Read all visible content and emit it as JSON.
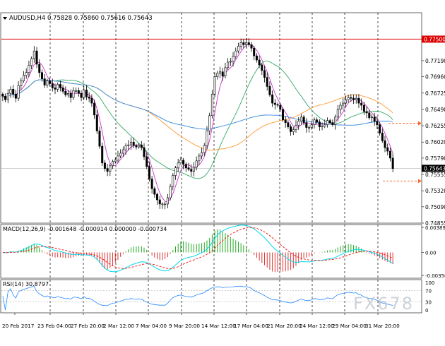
{
  "chart_data": {
    "type": "candlestick",
    "symbol_line": "AUDUSD,H4  0.75828 0.75860 0.75616 0.75643",
    "price_axis": {
      "min": 0.74855,
      "max": 0.7788,
      "ticks": [
        "0.77500",
        "0.77190",
        "0.76960",
        "0.76725",
        "0.76490",
        "0.76255",
        "0.76020",
        "0.75790",
        "0.75555",
        "0.75320",
        "0.75090",
        "0.74855"
      ],
      "current_price_label": "0.75643",
      "current_price": 0.75643,
      "resistance_label": "0.77500",
      "resistance_level": 0.775
    },
    "time_labels": [
      "20 Feb 2017",
      "23 Feb 04:00",
      "27 Feb 20:00",
      "2 Mar 12:00",
      "7 Mar 04:00",
      "9 Mar 20:00",
      "14 Mar 12:00",
      "17 Mar 04:00",
      "21 Mar 20:00",
      "24 Mar 12:00",
      "29 Mar 04:00",
      "31 Mar 20:00"
    ],
    "closes": [
      0.7668,
      0.7663,
      0.7672,
      0.7678,
      0.7671,
      0.7665,
      0.7683,
      0.769,
      0.7698,
      0.7702,
      0.7712,
      0.7722,
      0.7733,
      0.7714,
      0.7702,
      0.7693,
      0.7684,
      0.769,
      0.7686,
      0.768,
      0.7678,
      0.7685,
      0.768,
      0.7675,
      0.767,
      0.7672,
      0.7666,
      0.7676,
      0.7676,
      0.7672,
      0.7666,
      0.7677,
      0.7667,
      0.7665,
      0.7658,
      0.7641,
      0.7618,
      0.7596,
      0.7572,
      0.7564,
      0.756,
      0.7568,
      0.7574,
      0.7576,
      0.7582,
      0.7586,
      0.7591,
      0.7597,
      0.7598,
      0.7602,
      0.7597,
      0.7595,
      0.7598,
      0.7594,
      0.7581,
      0.7567,
      0.7549,
      0.7535,
      0.7527,
      0.7519,
      0.7513,
      0.7513,
      0.7513,
      0.7522,
      0.7538,
      0.7554,
      0.7565,
      0.7572,
      0.7576,
      0.757,
      0.7565,
      0.7563,
      0.756,
      0.7566,
      0.7575,
      0.7582,
      0.7587,
      0.7597,
      0.7618,
      0.764,
      0.7671,
      0.7696,
      0.7701,
      0.7703,
      0.7697,
      0.7709,
      0.7717,
      0.7718,
      0.7725,
      0.7733,
      0.774,
      0.7745,
      0.7742,
      0.7745,
      0.7742,
      0.7737,
      0.7726,
      0.772,
      0.7713,
      0.7705,
      0.7695,
      0.7682,
      0.767,
      0.7658,
      0.7656,
      0.7655,
      0.7649,
      0.7634,
      0.763,
      0.7624,
      0.7617,
      0.762,
      0.7626,
      0.7632,
      0.7638,
      0.763,
      0.7623,
      0.7623,
      0.7627,
      0.7634,
      0.7631,
      0.7624,
      0.7625,
      0.7627,
      0.7633,
      0.763,
      0.7627,
      0.7638,
      0.7649,
      0.7655,
      0.7658,
      0.7663,
      0.7666,
      0.7665,
      0.7663,
      0.7665,
      0.7658,
      0.7655,
      0.7646,
      0.7644,
      0.7637,
      0.7638,
      0.7632,
      0.7627,
      0.7615,
      0.7604,
      0.7594,
      0.7589,
      0.7579,
      0.7564
    ],
    "moving_averages": [
      {
        "color": "#cc33cc",
        "period": 5
      },
      {
        "color": "#33aa66",
        "period": 21
      },
      {
        "color": "#ff9933",
        "period": 55
      },
      {
        "color": "#3388dd",
        "period": 100
      }
    ],
    "macd": {
      "label": "MACD(12,26,9) -0.001648 -0.000914 0.000000 -0.000734",
      "ticks": [
        "0.003899",
        "0.00",
        "-0.003566"
      ],
      "range": [
        -0.003566,
        0.003899
      ],
      "macd_color": "#00d8f0",
      "signal_color": "#ee2222",
      "hist_pos_color": "#22aa22",
      "hist_neg_color": "#dd3333"
    },
    "rsi": {
      "label": "RSI(14) 30.8797",
      "ticks": [
        "100",
        "70",
        "30",
        "0"
      ],
      "range": [
        0,
        100
      ],
      "line_color": "#2288ff"
    },
    "watermark": "FX678",
    "colors": {
      "candle": "#000000",
      "resistance": "#dd0000",
      "projection": "#ff6633",
      "grid": "#000000",
      "price_line": "#c0c0c0",
      "price_label_bg": "#000000",
      "price_label_fg": "#ffffff",
      "resistance_label_bg": "#dd0000"
    }
  }
}
